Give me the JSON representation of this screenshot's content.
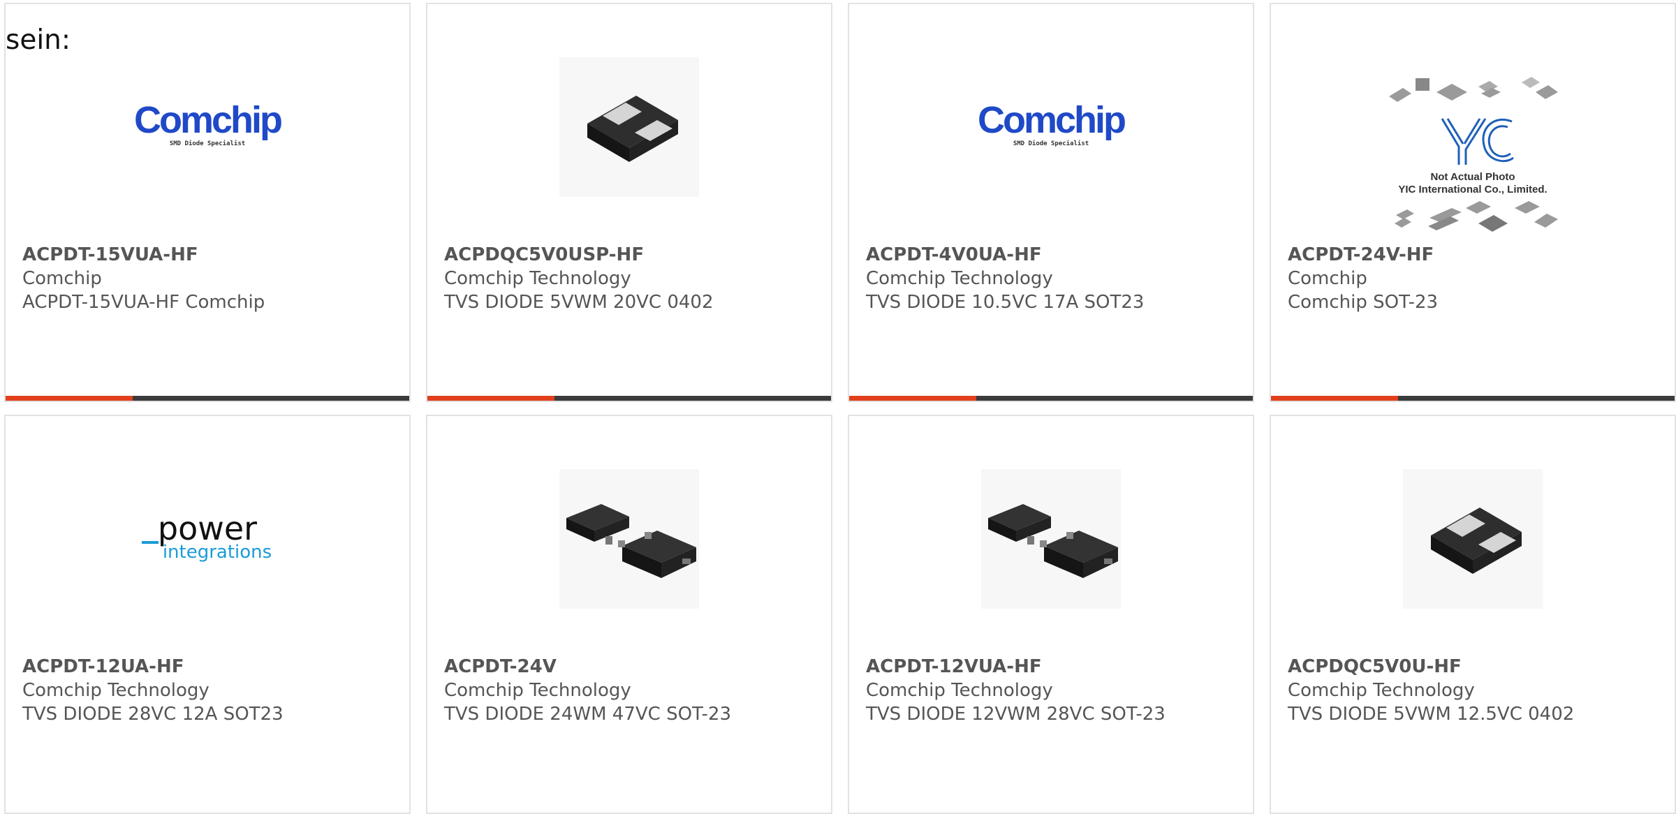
{
  "page": {
    "intro_text": "sein:"
  },
  "colors": {
    "accent": "#e2401c",
    "bar": "#3b3b3b",
    "comchip_blue": "#1f49c7",
    "power_blue": "#1a9bd7"
  },
  "products": [
    {
      "part": "ACPDT-15VUA-HF",
      "maker": "Comchip",
      "desc": "ACPDT-15VUA-HF Comchip",
      "image": "comchip-logo",
      "logo_text": "Comchip",
      "logo_sub": "SMD Diode Specialist"
    },
    {
      "part": "ACPDQC5V0USP-HF",
      "maker": "Comchip Technology",
      "desc": "TVS DIODE 5VWM 20VC 0402",
      "image": "chip-0402-icon"
    },
    {
      "part": "ACPDT-4V0UA-HF",
      "maker": "Comchip Technology",
      "desc": "TVS DIODE 10.5VC 17A SOT23",
      "image": "comchip-logo",
      "logo_text": "Comchip",
      "logo_sub": "SMD Diode Specialist"
    },
    {
      "part": "ACPDT-24V-HF",
      "maker": "Comchip",
      "desc": "Comchip SOT-23",
      "image": "yic-placeholder",
      "logo_line1": "Not Actual Photo",
      "logo_line2": "YIC International Co., Limited."
    },
    {
      "part": "ACPDT-12UA-HF",
      "maker": "Comchip Technology",
      "desc": "TVS DIODE 28VC 12A SOT23",
      "image": "power-integrations-logo",
      "logo_text": "power",
      "logo_sub": "integrations"
    },
    {
      "part": "ACPDT-24V",
      "maker": "Comchip Technology",
      "desc": "TVS DIODE 24WM 47VC SOT-23",
      "image": "sot23-icon"
    },
    {
      "part": "ACPDT-12VUA-HF",
      "maker": "Comchip Technology",
      "desc": "TVS DIODE 12VWM 28VC SOT-23",
      "image": "sot23-icon"
    },
    {
      "part": "ACPDQC5V0U-HF",
      "maker": "Comchip Technology",
      "desc": "TVS DIODE 5VWM 12.5VC 0402",
      "image": "chip-0402-icon"
    }
  ]
}
